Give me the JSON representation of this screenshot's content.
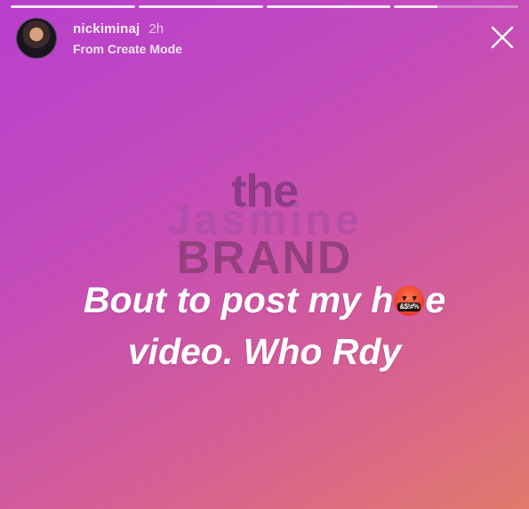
{
  "story": {
    "username": "nickiminaj",
    "timestamp": "2h",
    "subtitle": "From Create Mode",
    "progress": [
      1,
      1,
      1,
      0.35
    ]
  },
  "watermark": {
    "line1": "the",
    "line2": "Jasmine",
    "line3": "BRAND"
  },
  "caption": {
    "line1_before": "Bout to post my h",
    "line1_emoji_text": "&$!#%",
    "line1_after": "e",
    "line2": "video. Who Rdy"
  },
  "icons": {
    "close": "close-icon",
    "avatar": "avatar",
    "emoji": "cursing-face-emoji"
  }
}
